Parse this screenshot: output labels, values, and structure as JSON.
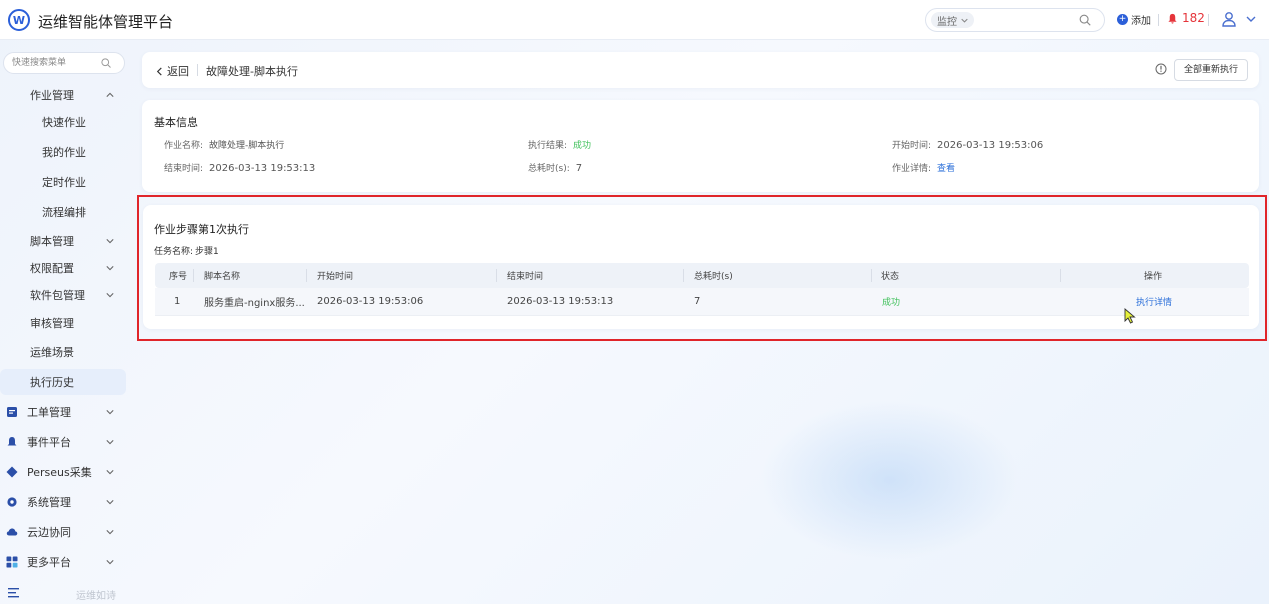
{
  "app": {
    "logo_text": "W",
    "title": "运维智能体管理平台"
  },
  "topbar": {
    "search_scope": "监控",
    "add_label": "添加",
    "alarm_count": "182"
  },
  "sidebar": {
    "search_placeholder": "快速搜索菜单",
    "groups": [
      {
        "label": "作业管理"
      },
      {
        "label": "快速作业"
      },
      {
        "label": "我的作业"
      },
      {
        "label": "定时作业"
      },
      {
        "label": "流程编排"
      },
      {
        "label": "脚本管理"
      },
      {
        "label": "权限配置"
      },
      {
        "label": "软件包管理"
      },
      {
        "label": "审核管理"
      },
      {
        "label": "运维场景"
      },
      {
        "label": "执行历史"
      },
      {
        "label": "工单管理"
      },
      {
        "label": "事件平台"
      },
      {
        "label": "Perseus采集"
      },
      {
        "label": "系统管理"
      },
      {
        "label": "云边协同"
      },
      {
        "label": "更多平台"
      }
    ],
    "footer_text": "运维如诗",
    "colors": {
      "active_bg": "#e6eefb",
      "icon": "#2b4fa8"
    }
  },
  "header": {
    "back_label": "返回",
    "title": "故障处理-脚本执行",
    "rerun_label": "全部重新执行"
  },
  "basic_info": {
    "title": "基本信息",
    "job_name_label": "作业名称:",
    "job_name": "故障处理-脚本执行",
    "result_label": "执行结果:",
    "result": "成功",
    "start_label": "开始时间:",
    "start_time": "2026-03-13 19:53:06",
    "end_label": "结束时间:",
    "end_time": "2026-03-13 19:53:13",
    "duration_label": "总耗时(s):",
    "duration": "7",
    "detail_label": "作业详情:",
    "detail_link": "查看"
  },
  "steps": {
    "title": "作业步骤第1次执行",
    "task_label": "任务名称:",
    "task_name": "步骤1",
    "columns": [
      "序号",
      "脚本名称",
      "开始时间",
      "结束时间",
      "总耗时(s)",
      "状态",
      "操作"
    ],
    "rows": [
      {
        "index": "1",
        "script": "服务重启-nginx服务...",
        "start": "2026-03-13 19:53:06",
        "end": "2026-03-13 19:53:13",
        "duration": "7",
        "status": "成功",
        "action": "执行详情"
      }
    ]
  },
  "colors": {
    "brand": "#2b5fd9",
    "success": "#3fc15a",
    "alarm": "#e5343a",
    "highlight_frame": "#e0252a"
  }
}
